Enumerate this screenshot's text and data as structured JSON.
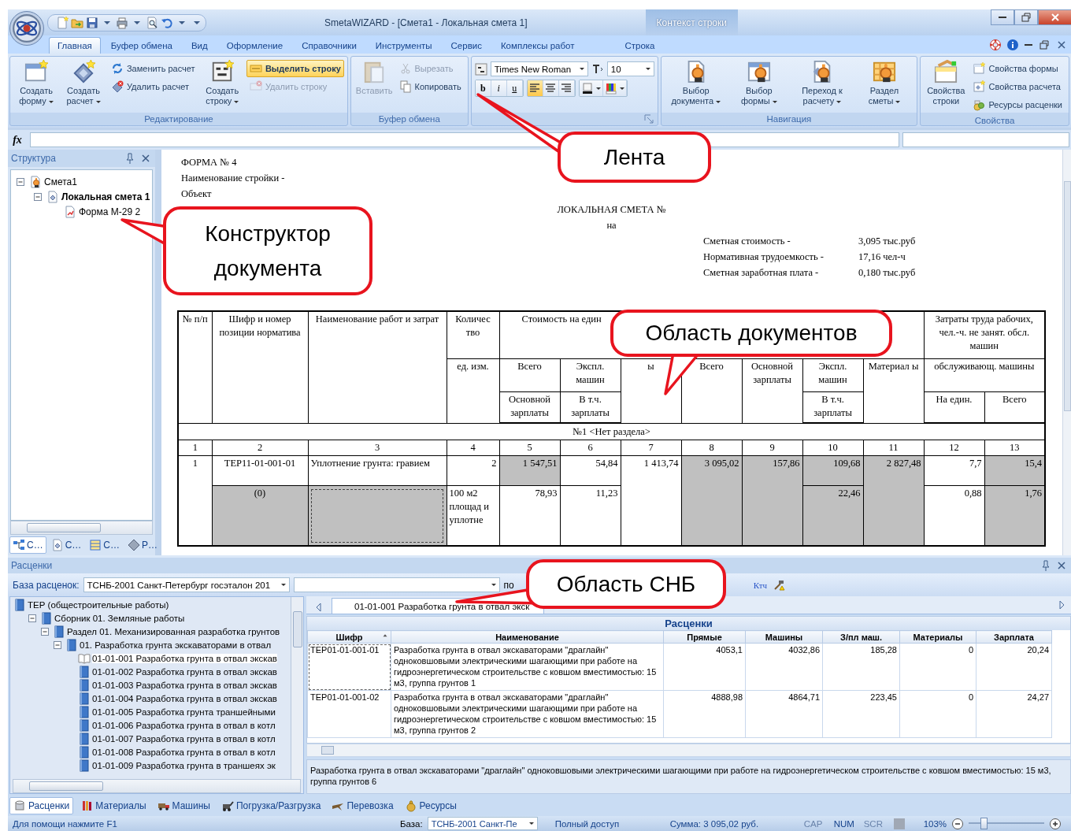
{
  "window": {
    "title": "SmetaWIZARD - [Смета1 - Локальная смета 1]",
    "context_tab_group": "Контекст строки"
  },
  "ribbon_tabs": [
    {
      "label": "Главная",
      "selected": true
    },
    {
      "label": "Буфер обмена",
      "selected": false
    },
    {
      "label": "Вид",
      "selected": false
    },
    {
      "label": "Оформление",
      "selected": false
    },
    {
      "label": "Справочники",
      "selected": false
    },
    {
      "label": "Инструменты",
      "selected": false
    },
    {
      "label": "Сервис",
      "selected": false
    },
    {
      "label": "Комплексы работ",
      "selected": false
    },
    {
      "label": "Строка",
      "selected": false
    }
  ],
  "ribbon_groups": [
    {
      "label": "Редактирование",
      "items": [
        {
          "kind": "large",
          "label": "Создать форму",
          "dropdown": true,
          "disabled": false
        },
        {
          "kind": "large",
          "label": "Создать расчет",
          "dropdown": true,
          "disabled": false
        },
        {
          "kind": "stack",
          "buttons": [
            {
              "label": "Заменить расчет",
              "highlighted": false,
              "disabled": false
            },
            {
              "label": "Удалить расчет",
              "highlighted": false,
              "disabled": false
            }
          ]
        },
        {
          "kind": "large",
          "label": "Создать строку",
          "dropdown": true,
          "disabled": false
        },
        {
          "kind": "stack",
          "buttons": [
            {
              "label": "Выделить строку",
              "highlighted": true,
              "disabled": false
            },
            {
              "label": "Удалить строку",
              "highlighted": false,
              "disabled": true
            }
          ]
        }
      ]
    },
    {
      "label": "Буфер обмена",
      "items": [
        {
          "kind": "large",
          "label": "Вставить",
          "dropdown": false,
          "disabled": true
        },
        {
          "kind": "stack",
          "buttons": [
            {
              "label": "Вырезать",
              "highlighted": false,
              "disabled": true
            },
            {
              "label": "Копировать",
              "highlighted": false,
              "disabled": false
            }
          ]
        }
      ]
    },
    {
      "items": [
        {
          "kind": "font",
          "font_name": "Times New Roman",
          "font_size": "10",
          "styles": [
            {
              "label": "b",
              "selected": false
            },
            {
              "label": "i",
              "selected": false
            },
            {
              "label": "u",
              "selected": false
            }
          ],
          "alignment": [
            {
              "selected": true
            },
            {
              "selected": false
            },
            {
              "selected": false
            }
          ]
        }
      ]
    },
    {
      "label": "Навигация",
      "items": [
        {
          "kind": "large",
          "label": "Выбор документа",
          "dropdown": true,
          "disabled": false
        },
        {
          "kind": "large",
          "label": "Выбор формы",
          "dropdown": true,
          "disabled": false
        },
        {
          "kind": "large",
          "label": "Переход к расчету",
          "dropdown": true,
          "disabled": false
        },
        {
          "kind": "large",
          "label": "Раздел сметы",
          "dropdown": true,
          "disabled": false
        }
      ]
    },
    {
      "label": "Свойства",
      "items": [
        {
          "kind": "large",
          "label": "Свойства строки",
          "dropdown": false,
          "disabled": false
        },
        {
          "kind": "stack",
          "buttons": [
            {
              "label": "Свойства формы",
              "highlighted": false,
              "disabled": false
            },
            {
              "label": "Свойства расчета",
              "highlighted": false,
              "disabled": false
            },
            {
              "label": "Ресурсы расценки",
              "highlighted": false,
              "disabled": false
            }
          ]
        }
      ]
    }
  ],
  "formula_bar": {
    "label": "fx"
  },
  "structure_panel": {
    "title": "Структура",
    "tree": [
      {
        "label": "Смета1",
        "active": false,
        "expanded": true,
        "children": [
          {
            "label": "Локальная смета 1",
            "active": true,
            "expanded": true,
            "children": [
              {
                "label": "Форма М-29 2",
                "active": false
              }
            ]
          }
        ]
      }
    ],
    "tabs": [
      {
        "label": "С…",
        "selected": true
      },
      {
        "label": "С…",
        "selected": false
      },
      {
        "label": "С…",
        "selected": false
      },
      {
        "label": "Р…",
        "selected": false
      }
    ]
  },
  "document": {
    "form_title": "ФОРМА № 4",
    "lines": [
      "Наименование стройки -",
      "Объект"
    ],
    "title": "ЛОКАЛЬНАЯ СМЕТА №",
    "subtitle": "на",
    "summary": [
      {
        "label": "Сметная стоимость -",
        "value": "3,095 тыс.руб"
      },
      {
        "label": "Нормативная трудоемкость -",
        "value": "17,16 чел-ч"
      },
      {
        "label": "Сметная заработная плата -",
        "value": "0,180 тыс.руб"
      }
    ],
    "table": {
      "header_rows": [
        [
          {
            "text": "№ п/п",
            "rowspan": 3
          },
          {
            "text": "Шифр и номер позиции норматива",
            "rowspan": 3
          },
          {
            "text": "Наименование работ и затрат",
            "rowspan": 3
          },
          {
            "text": "Количес тво"
          },
          {
            "text": "Стоимость на един",
            "colspan": 3
          },
          {
            "colspan": 4
          },
          {
            "text": "Затраты труда рабочих, чел.-ч. не занят. обсл. машин",
            "colspan": 2
          }
        ],
        [
          {
            "text": "ед. изм.",
            "rowspan": 2
          },
          {
            "text": "Всего"
          },
          {
            "text": "Экспл. машин"
          },
          {
            "text": "ы",
            "rowspan": 2
          },
          {
            "text": "Всего",
            "rowspan": 2
          },
          {
            "text": "Основной зарплаты",
            "rowspan": 2
          },
          {
            "text": "Экспл. машин"
          },
          {
            "text": "Материал ы",
            "rowspan": 2
          },
          {
            "text": "обслуживающ. машины",
            "colspan": 2
          }
        ],
        [
          {
            "text": "Основной зарплаты"
          },
          {
            "text": "В т.ч. зарплаты"
          },
          {
            "text": "В т.ч. зарплаты"
          },
          {
            "text": "На един."
          },
          {
            "text": "Всего"
          }
        ]
      ],
      "section": "№1 <Нет раздела>",
      "column_numbers": [
        "1",
        "2",
        "3",
        "4",
        "5",
        "6",
        "7",
        "8",
        "9",
        "10",
        "11",
        "12",
        "13"
      ],
      "rows": [
        [
          {
            "text": "1",
            "rowspan": 2,
            "shaded": false,
            "focused": false
          },
          {
            "text": "ТЕР11-01-001-01",
            "shaded": false,
            "focused": false
          },
          {
            "text": "Уплотнение грунта: гравием",
            "shaded": false,
            "focused": false
          },
          {
            "text": "2",
            "shaded": false,
            "focused": false
          },
          {
            "text": "1 547,51",
            "shaded": true,
            "focused": false
          },
          {
            "text": "54,84",
            "shaded": false,
            "focused": false
          },
          {
            "text": "1 413,74",
            "rowspan": 2,
            "shaded": false,
            "focused": false
          },
          {
            "text": "3 095,02",
            "rowspan": 2,
            "shaded": true,
            "focused": false
          },
          {
            "text": "157,86",
            "rowspan": 2,
            "shaded": true,
            "focused": false
          },
          {
            "text": "109,68",
            "shaded": true,
            "focused": false
          },
          {
            "text": "2 827,48",
            "rowspan": 2,
            "shaded": true,
            "focused": false
          },
          {
            "text": "7,7",
            "shaded": false,
            "focused": false
          },
          {
            "text": "15,4",
            "shaded": true,
            "focused": false
          }
        ],
        [
          {
            "text": "(0)",
            "shaded": true,
            "focused": false
          },
          {
            "shaded": true,
            "focused": true
          },
          {
            "text": "100 м2 площад и уплотне",
            "shaded": false,
            "focused": false
          },
          {
            "text": "78,93",
            "shaded": false,
            "focused": false
          },
          {
            "text": "11,23",
            "shaded": false,
            "focused": false
          },
          {
            "text": "22,46",
            "shaded": true,
            "focused": false
          },
          {
            "text": "0,88",
            "shaded": false,
            "focused": false
          },
          {
            "text": "1,76",
            "shaded": true,
            "focused": false
          }
        ]
      ]
    }
  },
  "rates_panel": {
    "title": "Расценки",
    "base_label": "База расценок:",
    "base_value": "ТСНБ-2001 Санкт-Петербург госэталон 201",
    "search_prefix": "по",
    "tool_label": "Ктч",
    "tree": [
      {
        "label": "ТЕР (общестроительные работы)",
        "selected": false,
        "children": [
          {
            "label": "Сборник 01. Земляные работы",
            "selected": false,
            "expanded": true,
            "children": [
              {
                "label": "Раздел 01. Механизированная разработка грунтов",
                "selected": false,
                "expanded": true,
                "children": [
                  {
                    "label": "01. Разработка грунта экскаваторами в отвал",
                    "selected": false,
                    "expanded": true,
                    "children": [
                      {
                        "label": "01-01-001 Разработка грунта в отвал экскав",
                        "selected": true
                      },
                      {
                        "label": "01-01-002 Разработка грунта в отвал экскав",
                        "selected": false
                      },
                      {
                        "label": "01-01-003 Разработка грунта в отвал экскав",
                        "selected": false
                      },
                      {
                        "label": "01-01-004 Разработка грунта в отвал экскав",
                        "selected": false
                      },
                      {
                        "label": "01-01-005 Разработка грунта траншейными",
                        "selected": false
                      },
                      {
                        "label": "01-01-006 Разработка грунта в отвал в котл",
                        "selected": false
                      },
                      {
                        "label": "01-01-007 Разработка грунта в отвал в котл",
                        "selected": false
                      },
                      {
                        "label": "01-01-008 Разработка грунта в отвал в котл",
                        "selected": false
                      },
                      {
                        "label": "01-01-009 Разработка грунта в траншеях эк",
                        "selected": false
                      }
                    ]
                  }
                ]
              }
            ]
          }
        ]
      }
    ],
    "open_tabs": [
      {
        "label": "01-01-001 Разработка грунта в отвал экск",
        "selected": true
      }
    ],
    "grid": {
      "caption": "Расценки",
      "columns": [
        {
          "label": "Шифр",
          "sorted": true
        },
        {
          "label": "Наименование",
          "sorted": false
        },
        {
          "label": "Прямые",
          "sorted": false
        },
        {
          "label": "Машины",
          "sorted": false
        },
        {
          "label": "З/пл маш.",
          "sorted": false
        },
        {
          "label": "Материалы",
          "sorted": false
        },
        {
          "label": "Зарплата",
          "sorted": false
        }
      ],
      "rows": [
        {
          "selected": true,
          "cells": [
            "ТЕР01-01-001-01",
            "Разработка грунта в отвал экскаваторами \"драглайн\" одноковшовыми электрическими шагающими при работе на гидроэнергетическом строительстве с ковшом вместимостью: 15 м3, группа грунтов 1",
            "4053,1",
            "4032,86",
            "185,28",
            "0",
            "20,24"
          ]
        },
        {
          "selected": false,
          "cells": [
            "ТЕР01-01-001-02",
            "Разработка грунта в отвал экскаваторами \"драглайн\" одноковшовыми электрическими шагающими при работе на гидроэнергетическом строительстве с ковшом вместимостью: 15 м3, группа грунтов 2",
            "4888,98",
            "4864,71",
            "223,45",
            "0",
            "24,27"
          ]
        }
      ]
    },
    "description": "Разработка грунта в отвал экскаваторами \"драглайн\" одноковшовыми электрическими шагающими при работе на гидроэнергетическом строительстве с ковшом вместимостью: 15 м3, группа грунтов 6"
  },
  "bottom_tabs": [
    {
      "label": "Расценки",
      "selected": true
    },
    {
      "label": "Материалы",
      "selected": false
    },
    {
      "label": "Машины",
      "selected": false
    },
    {
      "label": "Погрузка/Разгрузка",
      "selected": false
    },
    {
      "label": "Перевозка",
      "selected": false
    },
    {
      "label": "Ресурсы",
      "selected": false
    }
  ],
  "status_bar": {
    "help": "Для помощи нажмите F1",
    "base_label": "База:",
    "base_value": "ТСНБ-2001 Санкт-Пе",
    "access": "Полный доступ",
    "sum": "Сумма: 3 095,02 руб.",
    "indicators": [
      {
        "label": "CAP",
        "on": false
      },
      {
        "label": "NUM",
        "on": true
      },
      {
        "label": "SCR",
        "on": false
      }
    ],
    "zoom": "103%",
    "zoom_slider": {
      "level": 0.2
    }
  },
  "callouts": [
    {
      "text": "Лента"
    },
    {
      "text": "Конструктор документа"
    },
    {
      "text": "Область документов"
    },
    {
      "text": "Область СНБ"
    }
  ]
}
